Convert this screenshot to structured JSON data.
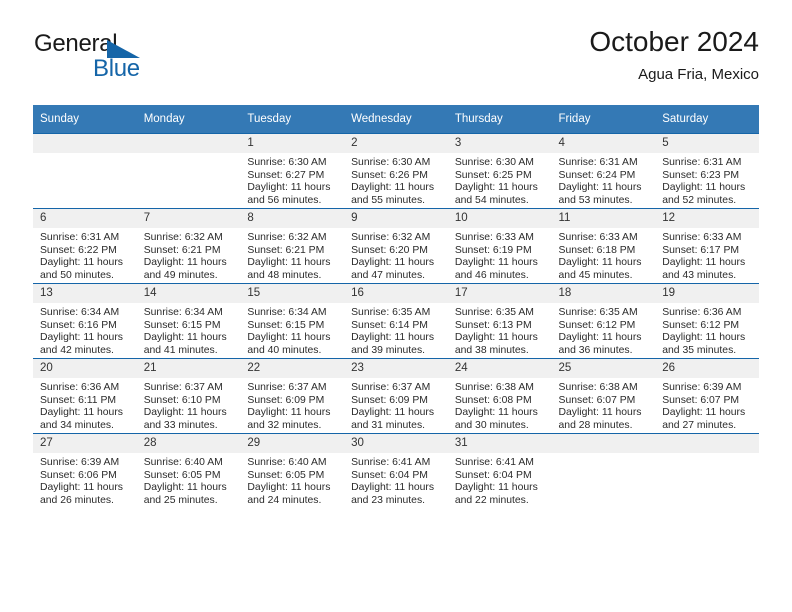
{
  "brand": {
    "line1": "General",
    "line2": "Blue",
    "triangle_color": "#1565a8",
    "text_color": "#1a1a1a"
  },
  "header": {
    "title": "October 2024",
    "subtitle": "Agua Fria, Mexico"
  },
  "theme": {
    "header_bg": "#3479b5",
    "row_rule": "#1565a8",
    "daynum_bg": "#f0f0f0",
    "page_bg": "#ffffff"
  },
  "calendar": {
    "weekday_headers": [
      "Sunday",
      "Monday",
      "Tuesday",
      "Wednesday",
      "Thursday",
      "Friday",
      "Saturday"
    ],
    "labels": {
      "sunrise": "Sunrise:",
      "sunset": "Sunset:",
      "daylight": "Daylight:"
    },
    "weeks": [
      [
        {
          "day": "",
          "empty": true
        },
        {
          "day": "",
          "empty": true
        },
        {
          "day": "1",
          "sunrise": "Sunrise: 6:30 AM",
          "sunset": "Sunset: 6:27 PM",
          "daylight": "Daylight: 11 hours and 56 minutes."
        },
        {
          "day": "2",
          "sunrise": "Sunrise: 6:30 AM",
          "sunset": "Sunset: 6:26 PM",
          "daylight": "Daylight: 11 hours and 55 minutes."
        },
        {
          "day": "3",
          "sunrise": "Sunrise: 6:30 AM",
          "sunset": "Sunset: 6:25 PM",
          "daylight": "Daylight: 11 hours and 54 minutes."
        },
        {
          "day": "4",
          "sunrise": "Sunrise: 6:31 AM",
          "sunset": "Sunset: 6:24 PM",
          "daylight": "Daylight: 11 hours and 53 minutes."
        },
        {
          "day": "5",
          "sunrise": "Sunrise: 6:31 AM",
          "sunset": "Sunset: 6:23 PM",
          "daylight": "Daylight: 11 hours and 52 minutes."
        }
      ],
      [
        {
          "day": "6",
          "sunrise": "Sunrise: 6:31 AM",
          "sunset": "Sunset: 6:22 PM",
          "daylight": "Daylight: 11 hours and 50 minutes."
        },
        {
          "day": "7",
          "sunrise": "Sunrise: 6:32 AM",
          "sunset": "Sunset: 6:21 PM",
          "daylight": "Daylight: 11 hours and 49 minutes."
        },
        {
          "day": "8",
          "sunrise": "Sunrise: 6:32 AM",
          "sunset": "Sunset: 6:21 PM",
          "daylight": "Daylight: 11 hours and 48 minutes."
        },
        {
          "day": "9",
          "sunrise": "Sunrise: 6:32 AM",
          "sunset": "Sunset: 6:20 PM",
          "daylight": "Daylight: 11 hours and 47 minutes."
        },
        {
          "day": "10",
          "sunrise": "Sunrise: 6:33 AM",
          "sunset": "Sunset: 6:19 PM",
          "daylight": "Daylight: 11 hours and 46 minutes."
        },
        {
          "day": "11",
          "sunrise": "Sunrise: 6:33 AM",
          "sunset": "Sunset: 6:18 PM",
          "daylight": "Daylight: 11 hours and 45 minutes."
        },
        {
          "day": "12",
          "sunrise": "Sunrise: 6:33 AM",
          "sunset": "Sunset: 6:17 PM",
          "daylight": "Daylight: 11 hours and 43 minutes."
        }
      ],
      [
        {
          "day": "13",
          "sunrise": "Sunrise: 6:34 AM",
          "sunset": "Sunset: 6:16 PM",
          "daylight": "Daylight: 11 hours and 42 minutes."
        },
        {
          "day": "14",
          "sunrise": "Sunrise: 6:34 AM",
          "sunset": "Sunset: 6:15 PM",
          "daylight": "Daylight: 11 hours and 41 minutes."
        },
        {
          "day": "15",
          "sunrise": "Sunrise: 6:34 AM",
          "sunset": "Sunset: 6:15 PM",
          "daylight": "Daylight: 11 hours and 40 minutes."
        },
        {
          "day": "16",
          "sunrise": "Sunrise: 6:35 AM",
          "sunset": "Sunset: 6:14 PM",
          "daylight": "Daylight: 11 hours and 39 minutes."
        },
        {
          "day": "17",
          "sunrise": "Sunrise: 6:35 AM",
          "sunset": "Sunset: 6:13 PM",
          "daylight": "Daylight: 11 hours and 38 minutes."
        },
        {
          "day": "18",
          "sunrise": "Sunrise: 6:35 AM",
          "sunset": "Sunset: 6:12 PM",
          "daylight": "Daylight: 11 hours and 36 minutes."
        },
        {
          "day": "19",
          "sunrise": "Sunrise: 6:36 AM",
          "sunset": "Sunset: 6:12 PM",
          "daylight": "Daylight: 11 hours and 35 minutes."
        }
      ],
      [
        {
          "day": "20",
          "sunrise": "Sunrise: 6:36 AM",
          "sunset": "Sunset: 6:11 PM",
          "daylight": "Daylight: 11 hours and 34 minutes."
        },
        {
          "day": "21",
          "sunrise": "Sunrise: 6:37 AM",
          "sunset": "Sunset: 6:10 PM",
          "daylight": "Daylight: 11 hours and 33 minutes."
        },
        {
          "day": "22",
          "sunrise": "Sunrise: 6:37 AM",
          "sunset": "Sunset: 6:09 PM",
          "daylight": "Daylight: 11 hours and 32 minutes."
        },
        {
          "day": "23",
          "sunrise": "Sunrise: 6:37 AM",
          "sunset": "Sunset: 6:09 PM",
          "daylight": "Daylight: 11 hours and 31 minutes."
        },
        {
          "day": "24",
          "sunrise": "Sunrise: 6:38 AM",
          "sunset": "Sunset: 6:08 PM",
          "daylight": "Daylight: 11 hours and 30 minutes."
        },
        {
          "day": "25",
          "sunrise": "Sunrise: 6:38 AM",
          "sunset": "Sunset: 6:07 PM",
          "daylight": "Daylight: 11 hours and 28 minutes."
        },
        {
          "day": "26",
          "sunrise": "Sunrise: 6:39 AM",
          "sunset": "Sunset: 6:07 PM",
          "daylight": "Daylight: 11 hours and 27 minutes."
        }
      ],
      [
        {
          "day": "27",
          "sunrise": "Sunrise: 6:39 AM",
          "sunset": "Sunset: 6:06 PM",
          "daylight": "Daylight: 11 hours and 26 minutes."
        },
        {
          "day": "28",
          "sunrise": "Sunrise: 6:40 AM",
          "sunset": "Sunset: 6:05 PM",
          "daylight": "Daylight: 11 hours and 25 minutes."
        },
        {
          "day": "29",
          "sunrise": "Sunrise: 6:40 AM",
          "sunset": "Sunset: 6:05 PM",
          "daylight": "Daylight: 11 hours and 24 minutes."
        },
        {
          "day": "30",
          "sunrise": "Sunrise: 6:41 AM",
          "sunset": "Sunset: 6:04 PM",
          "daylight": "Daylight: 11 hours and 23 minutes."
        },
        {
          "day": "31",
          "sunrise": "Sunrise: 6:41 AM",
          "sunset": "Sunset: 6:04 PM",
          "daylight": "Daylight: 11 hours and 22 minutes."
        },
        {
          "day": "",
          "empty": true
        },
        {
          "day": "",
          "empty": true
        }
      ]
    ]
  }
}
